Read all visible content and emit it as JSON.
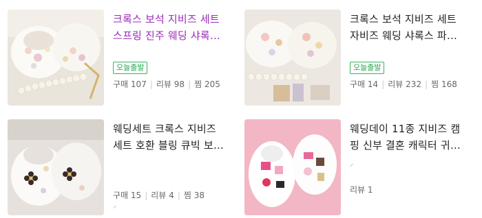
{
  "products": [
    {
      "title_line1": "크록스 보석 지비즈 세트",
      "title_line2": "스프링 진주 웨딩 샤록…",
      "visited": true,
      "badge": "오늘출발",
      "stats": [
        {
          "label": "구매",
          "value": "107"
        },
        {
          "label": "리뷰",
          "value": "98"
        },
        {
          "label": "찜",
          "value": "205"
        }
      ],
      "image_icon": "white-clogs-pearl-charms-image"
    },
    {
      "title_line1": "크록스 보석 지비즈 세트",
      "title_line2": "자비즈 웨딩 샤록스 파…",
      "visited": false,
      "badge": "오늘출발",
      "stats": [
        {
          "label": "구매",
          "value": "14"
        },
        {
          "label": "리뷰",
          "value": "232"
        },
        {
          "label": "찜",
          "value": "168"
        }
      ],
      "image_icon": "white-clogs-jewel-charms-image"
    },
    {
      "title_line1": "웨딩세트 크록스 지비즈",
      "title_line2": "세트 호환 블링 큐빅 보…",
      "visited": false,
      "badge": "",
      "stats": [
        {
          "label": "구매",
          "value": "15"
        },
        {
          "label": "리뷰",
          "value": "4"
        },
        {
          "label": "찜",
          "value": "38"
        }
      ],
      "image_icon": "white-clogs-flower-charms-image"
    },
    {
      "title_line1": "웨딩데이 11종 지비즈 캠",
      "title_line2": "핑 신부 결혼 캐릭터 귀…",
      "visited": false,
      "badge": "",
      "stats": [
        {
          "label": "리뷰",
          "value": "1"
        }
      ],
      "image_icon": "white-clogs-pink-charms-image"
    }
  ],
  "colors": {
    "visited_title": "#9a2ab7",
    "badge_green": "#1fa84a",
    "meta_gray": "#666666"
  }
}
